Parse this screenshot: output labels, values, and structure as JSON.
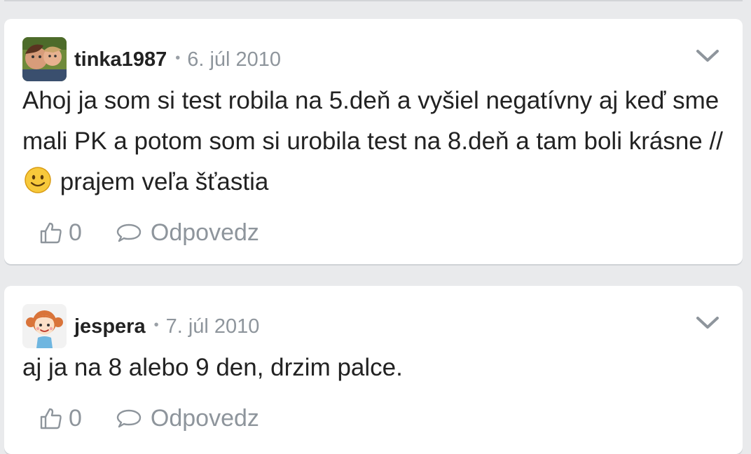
{
  "comments": [
    {
      "author": "tinka1987",
      "separator": "•",
      "date": "6. júl 2010",
      "text_before_emoji": "Ahoj ja som si test robila na 5.deň a vyšiel negatívny aj keď sme mali PK a potom som si urobila test na 8.deň a tam boli krásne //",
      "text_after_emoji": "prajem veľa šťastia",
      "emoji": "smiley-emoji",
      "likes": "0",
      "reply_label": "Odpovedz",
      "avatar": "photo-avatar"
    },
    {
      "author": "jespera",
      "separator": "•",
      "date": "7. júl 2010",
      "text_before_emoji": "aj ja na 8 alebo 9 den, drzim palce.",
      "text_after_emoji": "",
      "likes": "0",
      "reply_label": "Odpovedz",
      "avatar": "cartoon-girl-avatar"
    }
  ],
  "icons": {
    "menu": "chevron-down-icon",
    "like": "thumbs-up-icon",
    "reply": "speech-bubble-icon"
  },
  "colors": {
    "background": "#e9eaec",
    "card": "#ffffff",
    "text": "#222222",
    "muted": "#8e959c",
    "icon": "#8e959c"
  }
}
